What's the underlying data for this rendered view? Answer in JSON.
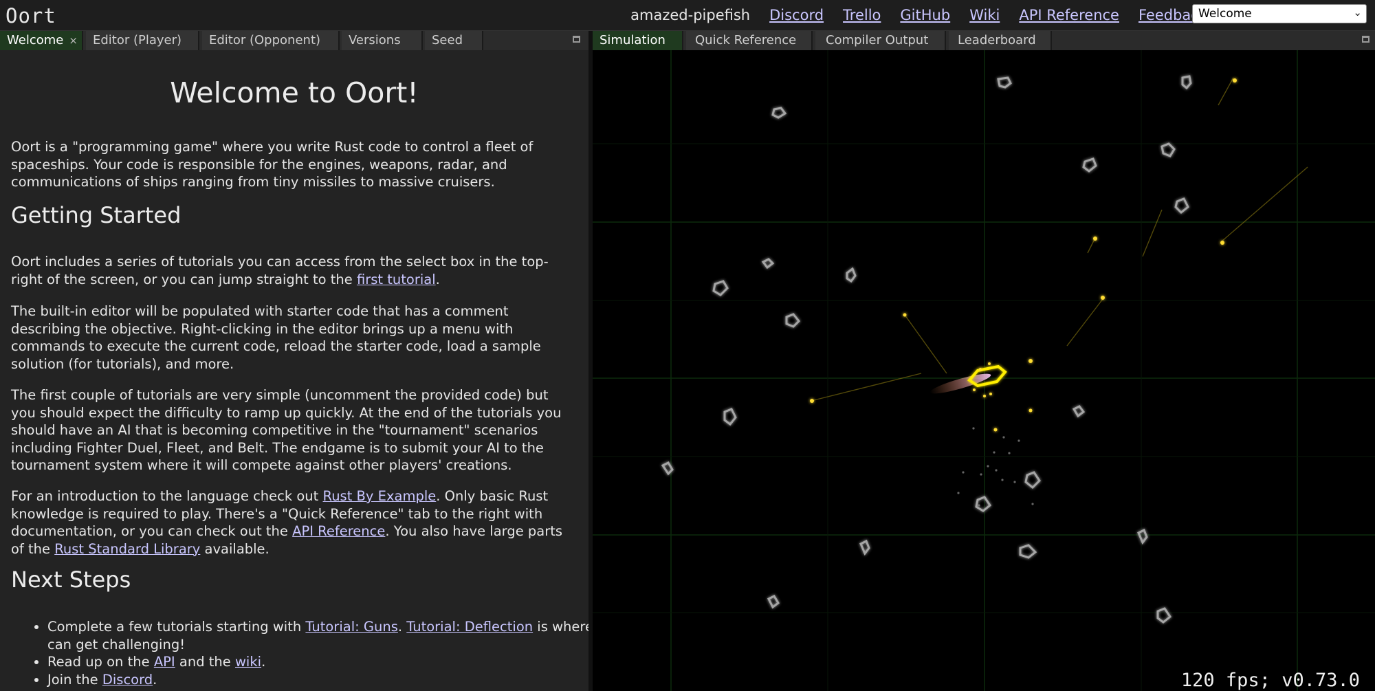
{
  "app": {
    "logo": "Oort"
  },
  "topbar": {
    "user": "amazed-pipefish",
    "links": [
      "Discord",
      "Trello",
      "GitHub",
      "Wiki",
      "API Reference",
      "Feedback"
    ],
    "scenario_select": {
      "value": "Welcome"
    }
  },
  "left_tabs": [
    {
      "label": "Welcome",
      "close": "×"
    },
    {
      "label": "Editor (Player)"
    },
    {
      "label": "Editor (Opponent)"
    },
    {
      "label": "Versions"
    },
    {
      "label": "Seed"
    }
  ],
  "right_tabs": [
    {
      "label": "Simulation"
    },
    {
      "label": "Quick Reference"
    },
    {
      "label": "Compiler Output"
    },
    {
      "label": "Leaderboard"
    }
  ],
  "welcome": {
    "title": "Welcome to Oort!",
    "intro": "Oort is a \"programming game\" where you write Rust code to control a fleet of spaceships. Your code is responsible for the engines, weapons, radar, and communications of ships ranging from tiny missiles to massive cruisers.",
    "getting_started_heading": "Getting Started",
    "p1_a": "Oort includes a series of tutorials you can access from the select box in the top-right of the screen, or you can jump straight to the ",
    "p1_link": "first tutorial",
    "p1_b": ".",
    "p2": "The built-in editor will be populated with starter code that has a comment describing the objective. Right-clicking in the editor brings up a menu with commands to execute the current code, reload the starter code, load a sample solution (for tutorials), and more.",
    "p3": "The first couple of tutorials are very simple (uncomment the provided code) but you should expect the difficulty to ramp up quickly. At the end of the tutorials you should have an AI that is becoming competitive in the \"tournament\" scenarios including Fighter Duel, Fleet, and Belt. The endgame is to submit your AI to the tournament system where it will compete against other players' creations.",
    "p4_a": "For an introduction to the language check out ",
    "p4_link1": "Rust By Example",
    "p4_b": ". Only basic Rust knowledge is required to play. There's a \"Quick Reference\" tab to the right with documentation, or you can check out the ",
    "p4_link2": "API Reference",
    "p4_c": ". You also have large parts of the ",
    "p4_link3": "Rust Standard Library",
    "p4_d": " available.",
    "next_steps_heading": "Next Steps",
    "li1_a": "Complete a few tutorials starting with ",
    "li1_link1": "Tutorial: Guns",
    "li1_b": ". ",
    "li1_link2": "Tutorial: Deflection",
    "li1_c": " is where it can get challenging!",
    "li2_a": "Read up on the ",
    "li2_link1": "API",
    "li2_b": " and the ",
    "li2_link2": "wiki",
    "li2_c": ".",
    "li3_a": "Join the ",
    "li3_link": "Discord",
    "li3_b": "."
  },
  "simulation": {
    "status": "120 fps; v0.73.0",
    "colors": {
      "grid": "#0c2a0c",
      "asteroid": "#9a9a9a",
      "ship": "#ffee00",
      "bullet": "#ffdd33"
    }
  }
}
